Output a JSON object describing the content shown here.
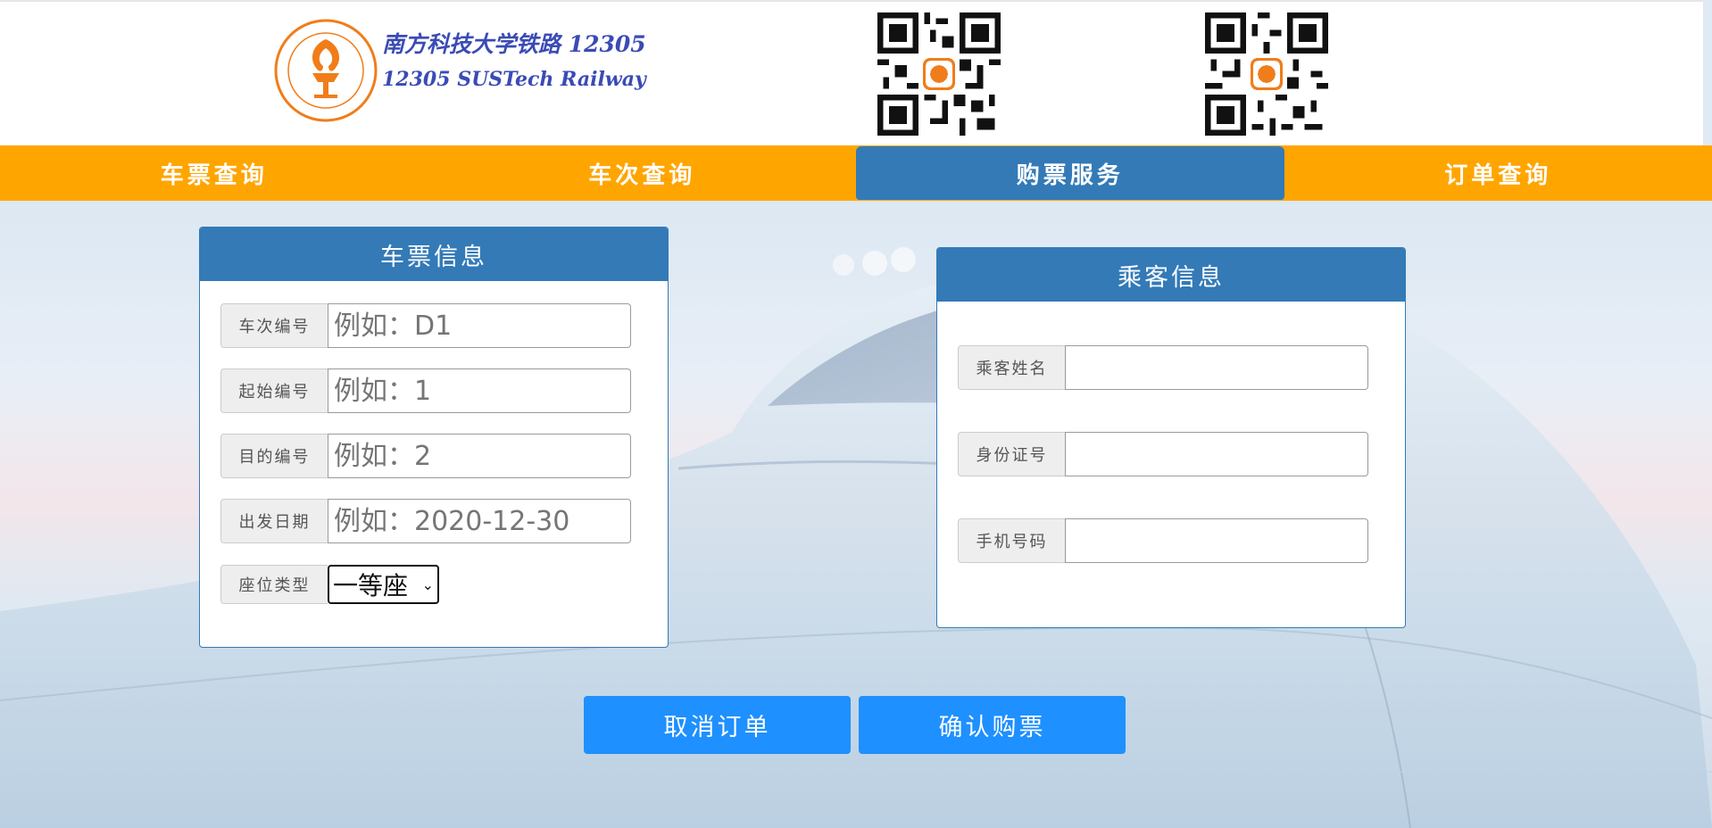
{
  "header": {
    "brand_cn": "南方科技大学铁路 12305",
    "brand_en": "12305 SUSTech Railway"
  },
  "nav": {
    "items": [
      {
        "label": "车票查询",
        "active": false
      },
      {
        "label": "车次查询",
        "active": false
      },
      {
        "label": "购票服务",
        "active": true
      },
      {
        "label": "订单查询",
        "active": false
      }
    ]
  },
  "ticket_panel": {
    "title": "车票信息",
    "fields": [
      {
        "label": "车次编号",
        "placeholder": "例如：D1",
        "value": ""
      },
      {
        "label": "起始编号",
        "placeholder": "例如：1",
        "value": ""
      },
      {
        "label": "目的编号",
        "placeholder": "例如：2",
        "value": ""
      },
      {
        "label": "出发日期",
        "placeholder": "例如：2020-12-30",
        "value": ""
      }
    ],
    "seat": {
      "label": "座位类型",
      "selected": "一等座"
    }
  },
  "passenger_panel": {
    "title": "乘客信息",
    "fields": [
      {
        "label": "乘客姓名",
        "value": ""
      },
      {
        "label": "身份证号",
        "value": ""
      },
      {
        "label": "手机号码",
        "value": ""
      }
    ]
  },
  "actions": {
    "cancel_label": "取消订单",
    "confirm_label": "确认购票"
  },
  "colors": {
    "nav_bg": "#ffa500",
    "primary": "#337ab7",
    "button": "#1e90ff",
    "brand_text": "#3a4bb5",
    "logo": "#f07d1a"
  },
  "icons": [
    "sustech-logo",
    "qr-code",
    "qr-code",
    "chevron-down-icon"
  ]
}
